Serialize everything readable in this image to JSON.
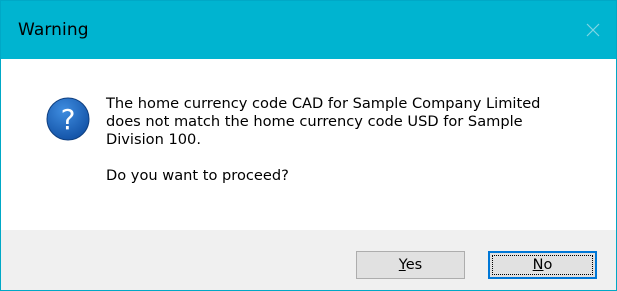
{
  "window": {
    "title": "Warning",
    "titlebar_color": "#00b4d0"
  },
  "icon": {
    "name": "question-icon",
    "glyph": "?",
    "color": "#1c5fb3"
  },
  "message": {
    "body": "The home currency code CAD for Sample Company Limited\ndoes not match the home currency code USD for Sample\nDivision 100.",
    "question": "Do you want to proceed?"
  },
  "buttons": {
    "yes": {
      "mnemonic": "Y",
      "rest": "es"
    },
    "no": {
      "mnemonic": "N",
      "rest": "o"
    }
  }
}
